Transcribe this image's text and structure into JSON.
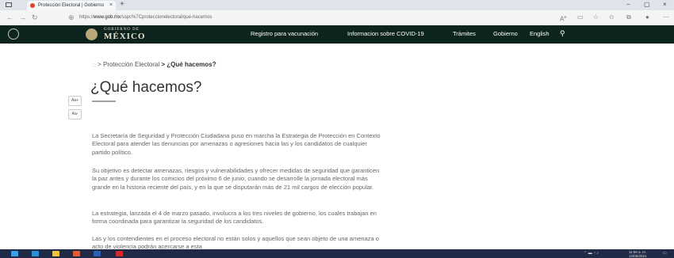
{
  "browser": {
    "tab_title": "Protección Electoral | Gobierno",
    "tab_close": "×",
    "new_tab": "+",
    "url_prefix": "https://",
    "url_host": "www.gob.mx",
    "url_path": "/sspc%7Cproteccionelectoral/que-hacemos",
    "window_controls": [
      "−",
      "▢",
      "×"
    ]
  },
  "gob_header": {
    "logo_top": "GOBIERNO DE",
    "logo_bottom": "MÉXICO",
    "nav": [
      "Registro para vacunación",
      "Informacion sobre COVID-19",
      "Trámites",
      "Gobierno",
      "English"
    ]
  },
  "text_size": {
    "increase": "Aa+",
    "decrease": "Aa-"
  },
  "breadcrumb": {
    "sep": ">",
    "section": "Protección Electoral",
    "current": "¿Qué hacemos?"
  },
  "page_title": "¿Qué hacemos?",
  "paragraphs": [
    "La Secretaría de Seguridad y Protección Ciudadana puso en marcha la Estrategia de Protección en Contexto Electoral para atender las denuncias por amenazas o agresiones hacia las y los candidatos de cualquier partido político.",
    "Su objetivo es detectar amenazas, riesgos y vulnerabilidades y  ofrecer medidas de seguridad que garanticen la paz antes y durante los comicios del próximo 6 de junio, cuando se desarrolle la jornada electoral más grande en la historia reciente del país, y en la que se disputarán más de 21 mil cargos de elección popular.",
    "La estrategia, lanzada el 4 de marzo pasado, involucra a los tres niveles de gobierno, los cuales trabajan en forma coordinada para garantizar la seguridad de los candidatos.",
    "Las y los contendientes en el proceso electoral no están solos y aquellos que sean objeto de una amenaza o acto de violencia podrán acercarse a esta"
  ],
  "taskbar": {
    "time": "11:50 a. m.",
    "date": "12/05/2021"
  },
  "colors": {
    "gob_header": "#0c231e",
    "taskbar": "#1e2a46",
    "title": "#333333",
    "body_text": "#666666"
  }
}
